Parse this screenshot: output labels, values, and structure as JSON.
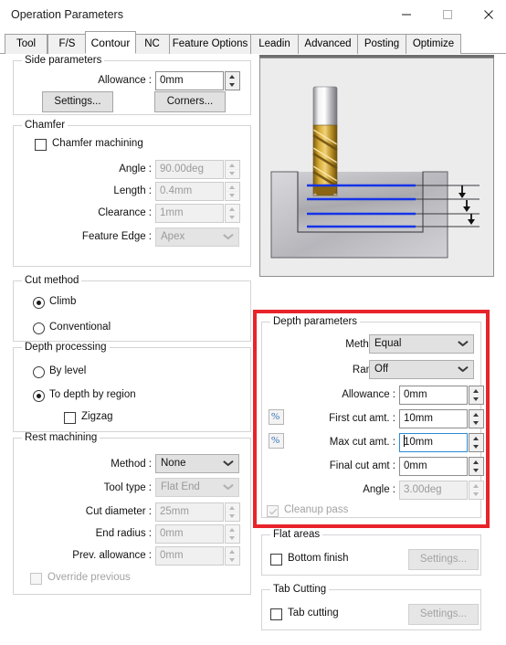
{
  "window": {
    "title": "Operation Parameters",
    "buttons": {
      "minimize": "minimize-icon",
      "maximize": "maximize-icon",
      "close": "close-icon"
    }
  },
  "tabs": [
    {
      "label": "Tool",
      "active": false
    },
    {
      "label": "F/S",
      "active": false
    },
    {
      "label": "Contour",
      "active": true
    },
    {
      "label": "NC",
      "active": false
    },
    {
      "label": "Feature Options",
      "active": false
    },
    {
      "label": "Leadin",
      "active": false
    },
    {
      "label": "Advanced",
      "active": false
    },
    {
      "label": "Posting",
      "active": false
    },
    {
      "label": "Optimize",
      "active": false
    }
  ],
  "side_parameters": {
    "title": "Side parameters",
    "allowance_label": "Allowance :",
    "allowance_value": "0mm",
    "settings_button": "Settings...",
    "corners_button": "Corners..."
  },
  "chamfer": {
    "title": "Chamfer",
    "machining_checkbox": "Chamfer machining",
    "angle_label": "Angle :",
    "angle_value": "90.00deg",
    "length_label": "Length :",
    "length_value": "0.4mm",
    "clearance_label": "Clearance :",
    "clearance_value": "1mm",
    "feature_edge_label": "Feature Edge :",
    "feature_edge_value": "Apex"
  },
  "cut_method": {
    "title": "Cut method",
    "options": [
      {
        "label": "Climb",
        "selected": true
      },
      {
        "label": "Conventional",
        "selected": false
      }
    ]
  },
  "depth_processing": {
    "title": "Depth processing",
    "options": [
      {
        "label": "By level",
        "selected": false
      },
      {
        "label": "To depth by region",
        "selected": true
      }
    ],
    "zigzag_checkbox": "Zigzag"
  },
  "rest_machining": {
    "title": "Rest machining",
    "method_label": "Method :",
    "method_value": "None",
    "tool_type_label": "Tool type :",
    "tool_type_value": "Flat End",
    "cut_diameter_label": "Cut diameter :",
    "cut_diameter_value": "25mm",
    "end_radius_label": "End radius :",
    "end_radius_value": "0mm",
    "prev_allowance_label": "Prev. allowance :",
    "prev_allowance_value": "0mm",
    "override_checkbox": "Override previous"
  },
  "depth_parameters": {
    "title": "Depth parameters",
    "method_label": "Method :",
    "method_value": "Equal",
    "ramp_label": "Ramp :",
    "ramp_value": "Off",
    "allowance_label": "Allowance :",
    "allowance_value": "0mm",
    "first_cut_label": "First cut amt. :",
    "first_cut_value": "10mm",
    "max_cut_label": "Max cut amt. :",
    "max_cut_value": "10mm",
    "final_cut_label": "Final cut amt :",
    "final_cut_value": "0mm",
    "angle_label": "Angle :",
    "angle_value": "3.00deg",
    "cleanup_checkbox": "Cleanup pass",
    "percent_button_glyph": "%",
    "highlight_color": "#e8232a"
  },
  "flat_areas": {
    "title": "Flat areas",
    "bottom_finish_checkbox": "Bottom finish",
    "settings_button": "Settings..."
  },
  "tab_cutting": {
    "title": "Tab Cutting",
    "tab_cutting_checkbox": "Tab cutting",
    "settings_button": "Settings..."
  },
  "preview": {
    "name": "contour-depth-preview",
    "description": "End mill cutting stepped depth passes in a pocket"
  }
}
